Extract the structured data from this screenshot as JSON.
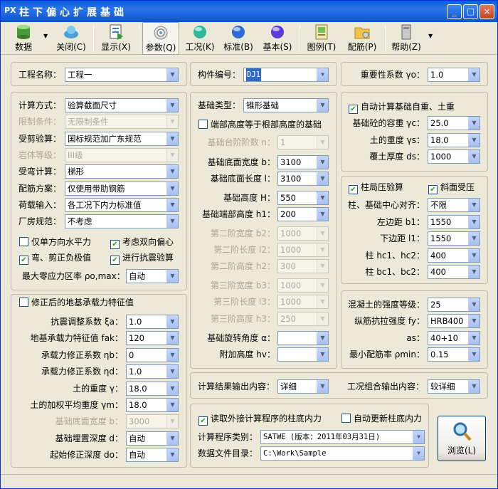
{
  "window": {
    "title": "柱下偏心扩展基础",
    "app_icon": "PX",
    "buttons": [
      "_",
      "□",
      "×"
    ]
  },
  "toolbar": [
    {
      "label": "数据",
      "icon": "database-icon"
    },
    {
      "label": "关闭(C)",
      "icon": "close-file-icon"
    },
    {
      "label": "显示(X)",
      "icon": "display-icon"
    },
    {
      "label": "参数(Q)",
      "icon": "params-icon"
    },
    {
      "label": "工况(K)",
      "icon": "green-ball-icon"
    },
    {
      "label": "标准(B)",
      "icon": "blue-ball-icon"
    },
    {
      "label": "基本(S)",
      "icon": "purple-ball-icon"
    },
    {
      "label": "图例(T)",
      "icon": "legend-icon"
    },
    {
      "label": "配筋(P)",
      "icon": "folder-icon"
    },
    {
      "label": "帮助(Z)",
      "icon": "help-icon"
    }
  ],
  "top": {
    "project_label": "工程名称：",
    "project_value": "工程一",
    "component_label": "构件编号：",
    "component_value": "DJ1",
    "importance_label": "重要性系数 γo：",
    "importance_value": "1.0"
  },
  "calc": {
    "method_label": "计算方式：",
    "method_value": "验算截面尺寸",
    "limit_label": "限制条件：",
    "limit_value": "无限制条件",
    "shear_label": "受剪验算：",
    "shear_value": "国标规范加广东规范",
    "rock_label": "岩体等级：",
    "rock_value": "III级",
    "bend_label": "受弯计算：",
    "bend_value": "梯形",
    "rebar_label": "配筋方案：",
    "rebar_value": "仅使用带肋钢筋",
    "load_label": "荷载输入：",
    "load_value": "各工况下内力标准值",
    "plant_label": "厂房规范：",
    "plant_value": "不考虑",
    "cb_single": "仅单方向水平力",
    "cb_biaxial": "考虑双向偏心",
    "cb_bend": "弯、剪正负极值",
    "cb_seismic": "进行抗震验算",
    "zero_label": "最大零应力区率 ρo,max：",
    "zero_value": "自动"
  },
  "bearing": {
    "title": "修正后的地基承载力特征值",
    "rows": [
      {
        "label": "抗震调整系数 ξa：",
        "value": "1.0",
        "disabled": false
      },
      {
        "label": "地基承载力特征值 fak：",
        "value": "120",
        "disabled": false
      },
      {
        "label": "承载力修正系数 ηb：",
        "value": "0",
        "disabled": false
      },
      {
        "label": "承载力修正系数 ηd：",
        "value": "1.0",
        "disabled": false
      },
      {
        "label": "土的重度 γ：",
        "value": "18.0",
        "disabled": false
      },
      {
        "label": "土的加权平均重度 γm：",
        "value": "18.0",
        "disabled": false
      },
      {
        "label": "基础底面宽度 b：",
        "value": "3000",
        "disabled": true
      },
      {
        "label": "基础埋置深度 d：",
        "value": "自动",
        "disabled": false
      },
      {
        "label": "起始修正深度 do：",
        "value": "自动",
        "disabled": false
      }
    ]
  },
  "foundation": {
    "type_label": "基础类型：",
    "type_value": "锥形基础",
    "cb_end": "端部高度等于根部高度的基础",
    "rows": [
      {
        "label": "基础台阶阶数 n：",
        "value": "1",
        "disabled": true
      },
      {
        "label": "基础底面宽度 b：",
        "value": "3100",
        "disabled": false
      },
      {
        "label": "基础底面长度 l：",
        "value": "3100",
        "disabled": false
      },
      {
        "label": "基础高度 H：",
        "value": "550",
        "disabled": false
      },
      {
        "label": "基础端部高度 h1：",
        "value": "200",
        "disabled": false
      },
      {
        "label": "第二阶宽度 b2：",
        "value": "1000",
        "disabled": true
      },
      {
        "label": "第二阶长度 l2：",
        "value": "1000",
        "disabled": true
      },
      {
        "label": "第二阶高度 h2：",
        "value": "300",
        "disabled": true
      },
      {
        "label": "第三阶宽度 b3：",
        "value": "1000",
        "disabled": true
      },
      {
        "label": "第三阶长度 l3：",
        "value": "1000",
        "disabled": true
      },
      {
        "label": "第三阶高度 h3：",
        "value": "250",
        "disabled": true
      },
      {
        "label": "基础旋转角度 α：",
        "value": "",
        "disabled": false
      },
      {
        "label": "附加高度 hv：",
        "value": "",
        "disabled": false
      }
    ]
  },
  "weight": {
    "cb_auto": "自动计算基础自重、土重",
    "rows": [
      {
        "label": "基础砼的容重 γc：",
        "value": "25.0"
      },
      {
        "label": "土的重度 γs：",
        "value": "18.0"
      },
      {
        "label": "覆土厚度 ds：",
        "value": "1000"
      }
    ]
  },
  "column": {
    "cb_local": "柱局压验算",
    "cb_slope": "斜面受压",
    "rows": [
      {
        "label": "柱、基础中心对齐：",
        "value": "不限"
      },
      {
        "label": "左边距 b1：",
        "value": "1550"
      },
      {
        "label": "下边距 l1：",
        "value": "1550"
      },
      {
        "label": "柱 hc1、hc2：",
        "value": "400"
      },
      {
        "label": "柱 bc1、bc2：",
        "value": "400"
      }
    ]
  },
  "material": {
    "rows": [
      {
        "label": "混凝土的强度等级：",
        "value": "25"
      },
      {
        "label": "纵筋抗拉强度 fy：",
        "value": "HRB400"
      },
      {
        "label": "as：",
        "value": "40+10"
      },
      {
        "label": "最小配筋率 ρmin：",
        "value": "0.15"
      }
    ]
  },
  "output": {
    "result_label": "计算结果输出内容：",
    "result_value": "详细",
    "combo_label": "工况组合输出内容：",
    "combo_value": "较详细"
  },
  "external": {
    "cb_read": "读取外接计算程序的柱底内力",
    "cb_update": "自动更新柱底内力",
    "program_label": "计算程序类别：",
    "program_value": "SATWE (版本：2011年03月31日)",
    "dir_label": "数据文件目录：",
    "dir_value": "C:\\Work\\Sample",
    "browse_label": "浏览(L)"
  }
}
